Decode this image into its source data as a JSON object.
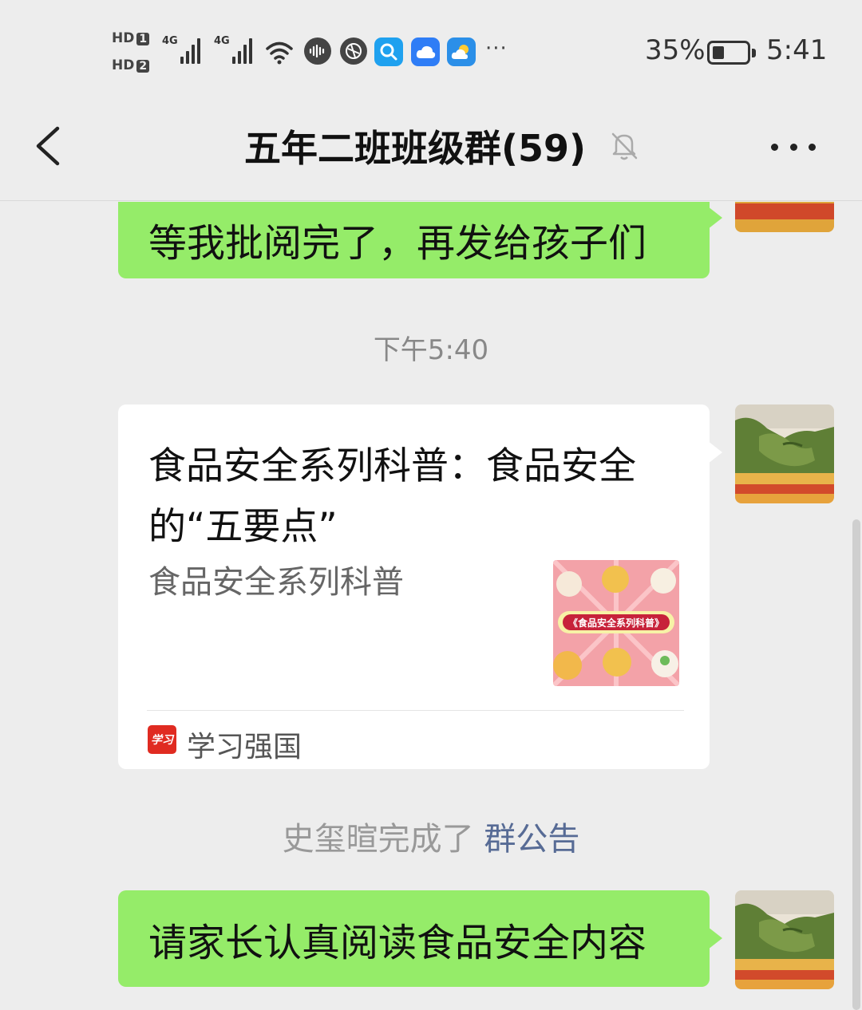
{
  "status_bar": {
    "sim1": "HD",
    "sim1_num": "1",
    "sim2": "HD",
    "sim2_num": "2",
    "network1": "4G",
    "network2": "4G",
    "more": "···",
    "battery_percent": "35%",
    "battery_level": 0.35,
    "time": "5:41",
    "icons": [
      "signal-icon",
      "signal-icon",
      "wifi-icon",
      "voice-icon",
      "browser-icon",
      "search-app-icon",
      "cloud-app-icon",
      "weather-app-icon"
    ]
  },
  "header": {
    "title": "五年二班班级群(59)",
    "muted": true
  },
  "messages": {
    "msg1_text": "等我批阅完了，再发给孩子们",
    "timestamp": "下午5:40",
    "card": {
      "title": "食品安全系列科普：食品安全的“五要点”",
      "description": "食品安全系列科普",
      "thumbnail_label": "《食品安全系列科普》",
      "source_icon_text": "学习",
      "source_name": "学习强国"
    },
    "system_notice": {
      "text": "史玺暄完成了",
      "link": "群公告"
    },
    "msg2_text": "请家长认真阅读食品安全内容"
  },
  "colors": {
    "background": "#ededed",
    "sent_bubble": "#95ec69",
    "link": "#576b95",
    "source_icon": "#e02b21"
  }
}
